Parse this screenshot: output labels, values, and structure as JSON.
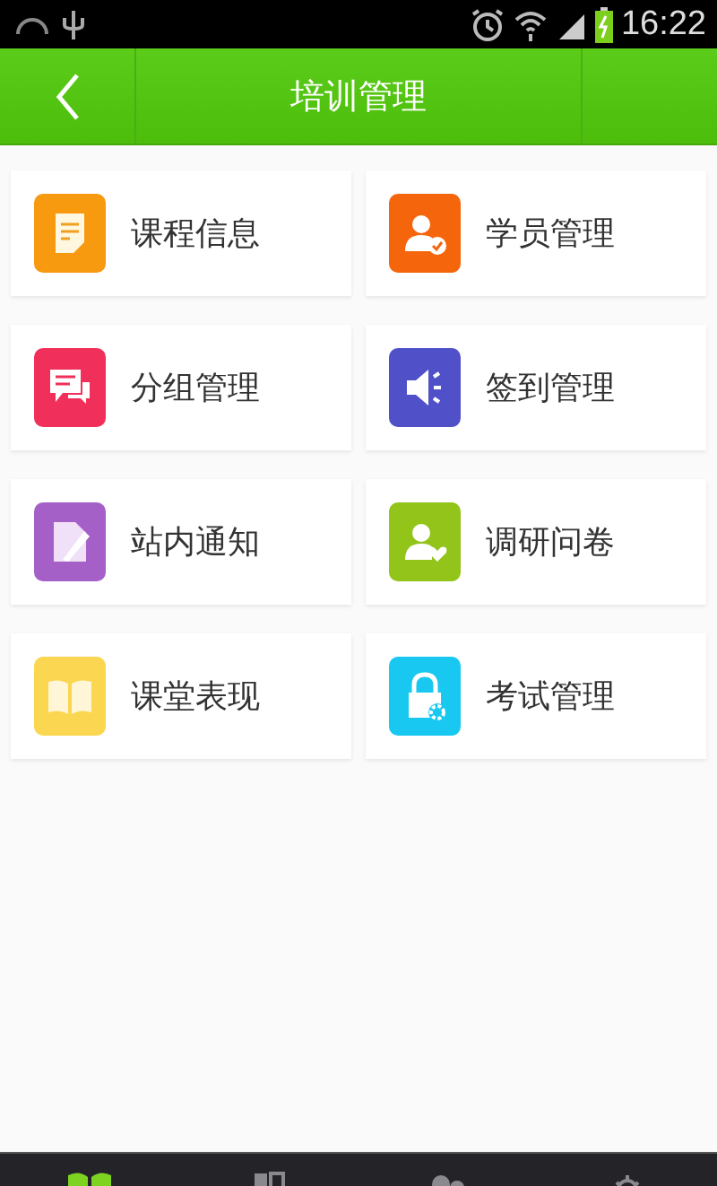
{
  "status_bar": {
    "time": "16:22"
  },
  "header": {
    "title": "培训管理"
  },
  "items": [
    {
      "label": "课程信息",
      "kind": "document",
      "color": "#f89a10"
    },
    {
      "label": "学员管理",
      "kind": "user-check",
      "color": "#f5650c"
    },
    {
      "label": "分组管理",
      "kind": "chat",
      "color": "#f0305a"
    },
    {
      "label": "签到管理",
      "kind": "speaker",
      "color": "#5050c8"
    },
    {
      "label": "站内通知",
      "kind": "note",
      "color": "#a560c8"
    },
    {
      "label": "调研问卷",
      "kind": "user-heart",
      "color": "#92c41a"
    },
    {
      "label": "课堂表现",
      "kind": "book",
      "color": "#fbd650"
    },
    {
      "label": "考试管理",
      "kind": "lock",
      "color": "#19c8f0"
    }
  ],
  "tabs": [
    {
      "kind": "book",
      "selected": true
    },
    {
      "kind": "panels",
      "selected": false
    },
    {
      "kind": "people",
      "selected": false
    },
    {
      "kind": "gear",
      "selected": false
    }
  ]
}
